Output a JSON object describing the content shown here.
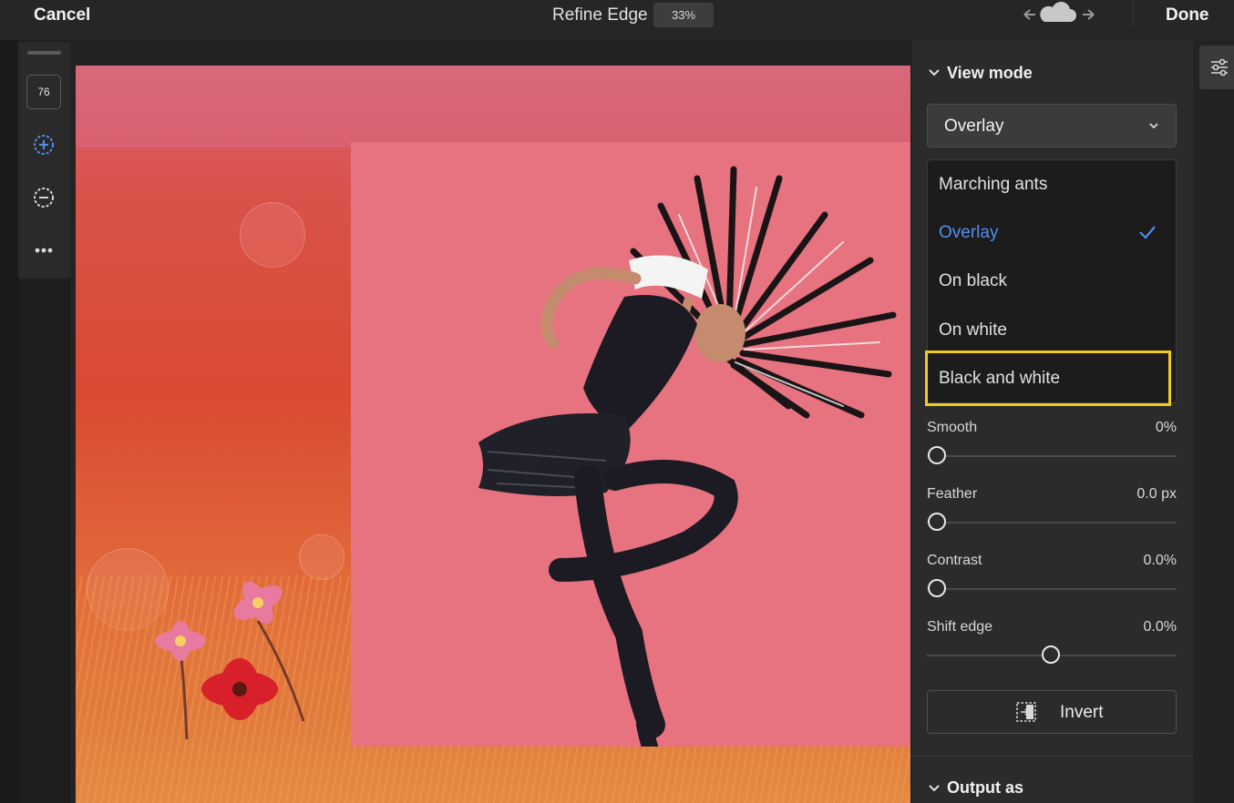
{
  "header": {
    "cancel_label": "Cancel",
    "title": "Refine Edge",
    "zoom": "33%",
    "done_label": "Done"
  },
  "toolbar": {
    "brush_size": "76",
    "tools": [
      "add-brush-icon",
      "subtract-brush-icon",
      "more-icon"
    ]
  },
  "panel": {
    "view_mode": {
      "heading": "View mode",
      "selected": "Overlay",
      "options": [
        "Marching ants",
        "Overlay",
        "On black",
        "On white",
        "Black and white"
      ],
      "highlighted": "Black and white"
    },
    "sliders": [
      {
        "label": "Smooth",
        "value": "0%",
        "level": 0.0
      },
      {
        "label": "Feather",
        "value": "0.0 px",
        "level": 0.0
      },
      {
        "label": "Contrast",
        "value": "0.0%",
        "level": 0.0
      },
      {
        "label": "Shift edge",
        "value": "0.0%",
        "level": 0.5
      }
    ],
    "invert_label": "Invert",
    "output": {
      "heading": "Output as"
    }
  },
  "colors": {
    "accent": "#4f8ff0",
    "highlight": "#f2cc1c",
    "overlay_pink": "#e6737f"
  }
}
